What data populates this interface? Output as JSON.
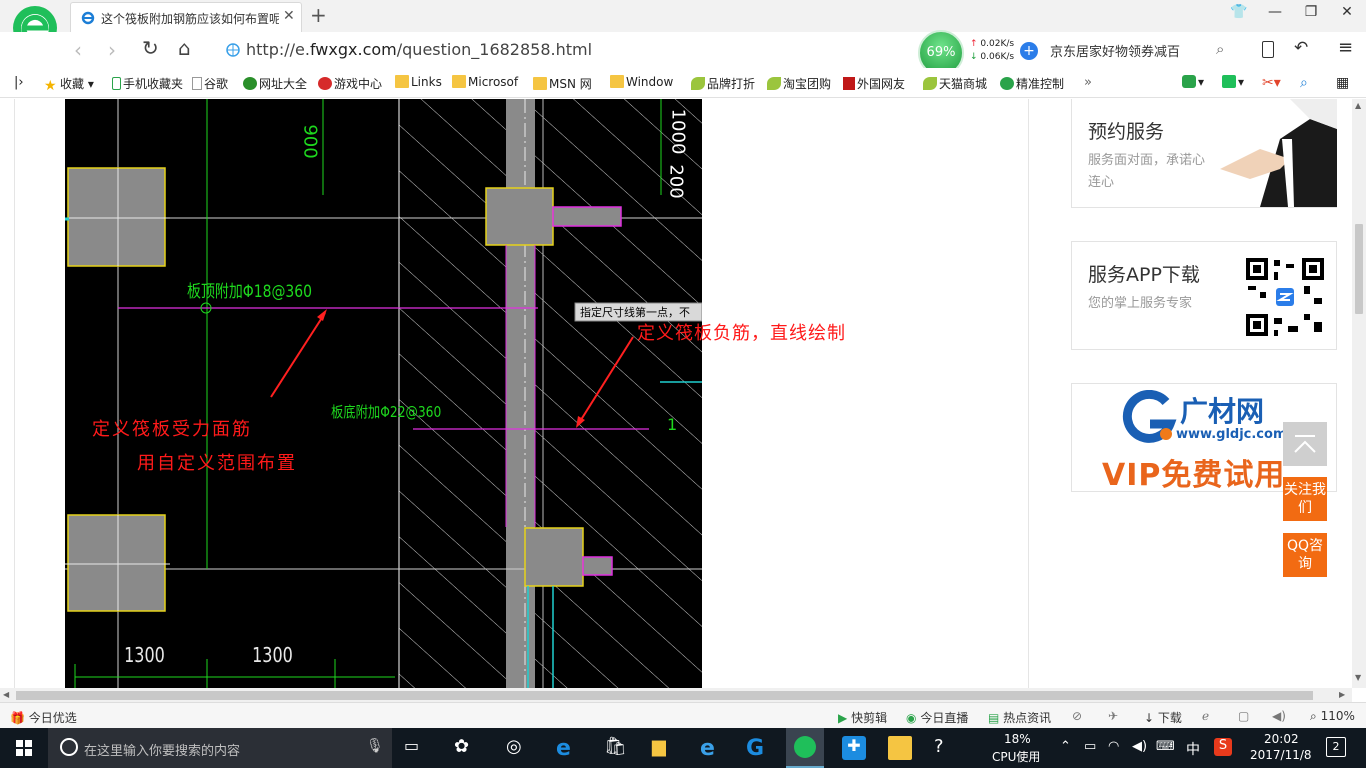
{
  "browser": {
    "tab": {
      "title": "这个筏板附加钢筋应该如何布置呢"
    },
    "url": {
      "prefix": "http://e.",
      "host": "fwxgx.com",
      "path": "/question_1682858.html"
    },
    "perf": {
      "cpu": "69%",
      "up": "0.02K/s",
      "down": "0.06K/s"
    },
    "search_hint": "京东居家好物领券减百"
  },
  "bookmarks": [
    {
      "label": "收藏"
    },
    {
      "label": "手机收藏夹"
    },
    {
      "label": "谷歌"
    },
    {
      "label": "网址大全"
    },
    {
      "label": "游戏中心"
    },
    {
      "label": "Links"
    },
    {
      "label": "Microsof"
    },
    {
      "label": "MSN 网"
    },
    {
      "label": "Window"
    },
    {
      "label": "品牌打折"
    },
    {
      "label": "淘宝团购"
    },
    {
      "label": "外国网友"
    },
    {
      "label": "天猫商城"
    },
    {
      "label": "精准控制"
    }
  ],
  "drawing": {
    "dims": [
      "900",
      "1000",
      "200",
      "1300",
      "1300",
      "1"
    ],
    "green_labels": [
      "板顶附加Φ18@360",
      "板底附加Φ22@360"
    ],
    "tooltip": "指定尺寸线第一点，不",
    "annotations": [
      "定义筏板受力面筋",
      "用自定义范围布置",
      "定义筏板负筋，直线绘制"
    ]
  },
  "sidebar": {
    "card1": {
      "title": "预约服务",
      "desc": "服务面对面，承诺心连心"
    },
    "card2": {
      "title": "服务APP下载",
      "desc": "您的掌上服务专家"
    },
    "card3": {
      "brand": "广材网",
      "url": "www.gldjc.com",
      "promo": "VIP免费试用"
    },
    "follow_btn": "关注我们",
    "qq_btn": "QQ咨询"
  },
  "statusbar": {
    "left": "今日优选",
    "items": [
      "快剪辑",
      "今日直播",
      "热点资讯",
      "下载"
    ],
    "zoom": "110%"
  },
  "taskbar": {
    "search_placeholder": "在这里输入你要搜索的内容",
    "cpu_pct": "18%",
    "cpu_label": "CPU使用",
    "ime": "中",
    "time": "20:02",
    "date": "2017/11/8",
    "notif": "2"
  }
}
